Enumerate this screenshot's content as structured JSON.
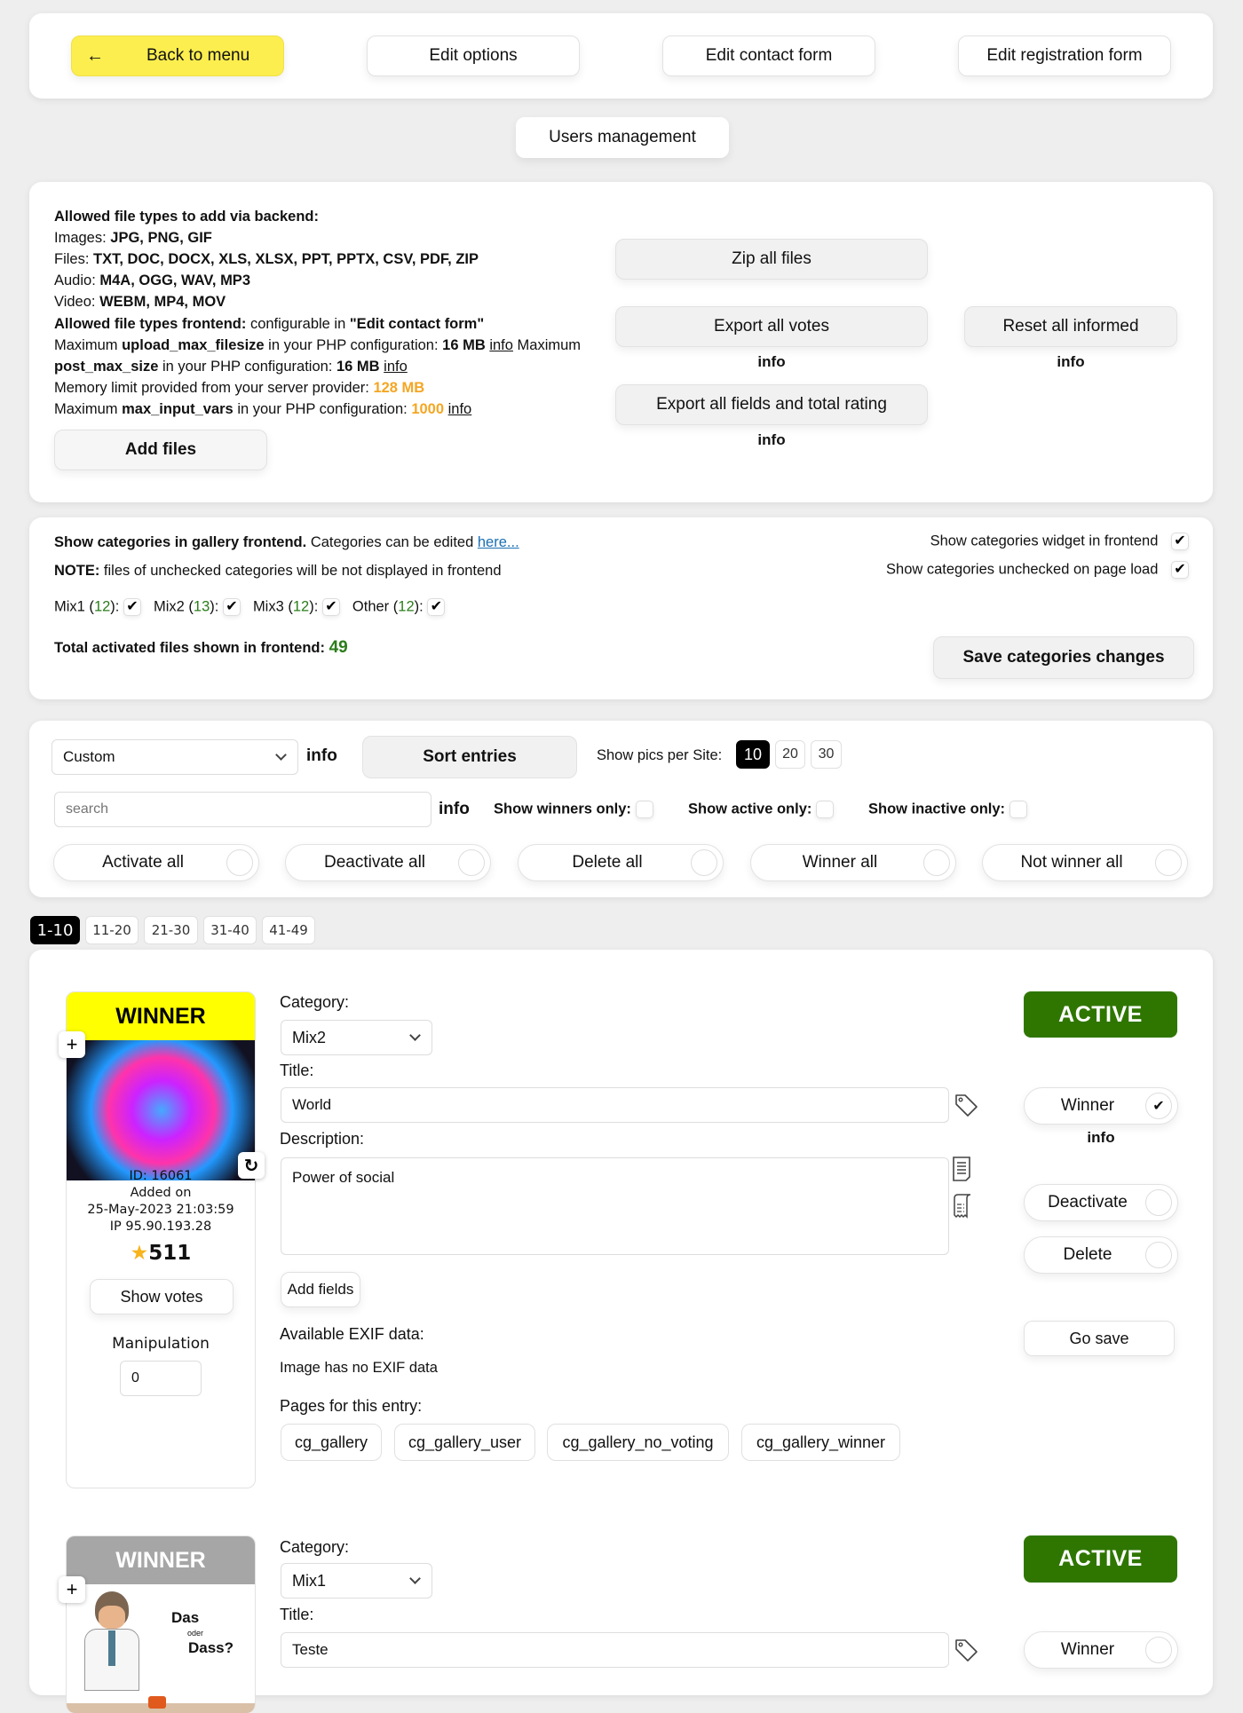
{
  "nav": {
    "back": "Back to menu",
    "edit_options": "Edit options",
    "edit_contact_form": "Edit contact form",
    "edit_registration_form": "Edit registration form",
    "users_management": "Users management"
  },
  "files_panel": {
    "heading": "Allowed file types to add via backend:",
    "images_label": "Images: ",
    "images_value": "JPG, PNG, GIF",
    "files_label": "Files: ",
    "files_value": "TXT, DOC, DOCX, XLS, XLSX, PPT, PPTX, CSV, PDF, ZIP",
    "audio_label": "Audio: ",
    "audio_value": "M4A, OGG, WAV, MP3",
    "video_label": "Video: ",
    "video_value": "WEBM, MP4, MOV",
    "frontend_label": "Allowed file types frontend:",
    "frontend_text": " configurable in ",
    "frontend_value": "\"Edit contact form\"",
    "upload_pre": "Maximum ",
    "upload_key": "upload_max_filesize",
    "upload_mid": " in your PHP configuration: ",
    "upload_value": "16 MB",
    "upload_info": "info",
    "upload_post": " Maximum",
    "post_key": "post_max_size",
    "post_mid": " in your PHP configuration: ",
    "post_value": "16 MB",
    "post_info": "info",
    "memory_text": "Memory limit provided from your server provider: ",
    "memory_value": "128 MB",
    "input_pre": "Maximum ",
    "input_key": "max_input_vars",
    "input_mid": " in your PHP configuration: ",
    "input_value": "1000",
    "input_info": "info",
    "add_files": "Add files",
    "zip_all": "Zip all files",
    "export_votes": "Export all votes",
    "export_votes_info": "info",
    "reset_informed": "Reset all informed",
    "reset_informed_info": "info",
    "export_fields": "Export all fields and total rating",
    "export_fields_info": "info"
  },
  "categories_panel": {
    "show_label": "Show categories in gallery frontend.",
    "edit_text": " Categories can be edited ",
    "edit_link": "here...",
    "note_label": "NOTE:",
    "note_text": " files of unchecked categories will be not displayed in frontend",
    "categories": [
      {
        "name": "Mix1",
        "count": "12",
        "checked": true
      },
      {
        "name": "Mix2",
        "count": "13",
        "checked": true
      },
      {
        "name": "Mix3",
        "count": "12",
        "checked": true
      },
      {
        "name": "Other",
        "count": "12",
        "checked": true
      }
    ],
    "total_label": "Total activated files shown in frontend:",
    "total_value": "49",
    "widget_label": "Show categories widget in frontend",
    "widget_checked": true,
    "unchecked_label": "Show categories unchecked on page load",
    "unchecked_checked": true,
    "save": "Save categories changes",
    "check_glyph": "✔"
  },
  "controls_panel": {
    "sort_select": "Custom",
    "sort_info": "info",
    "sort_button": "Sort entries",
    "per_site_label": "Show pics per Site:",
    "per_site_options": [
      "10",
      "20",
      "30"
    ],
    "per_site_selected": "10",
    "search_placeholder": "search",
    "search_value": "",
    "search_info": "info",
    "winners_only": "Show winners only:",
    "active_only": "Show active only:",
    "inactive_only": "Show inactive only:",
    "bulk": [
      "Activate all",
      "Deactivate all",
      "Delete all",
      "Winner all",
      "Not winner all"
    ]
  },
  "pagination": [
    "1-10",
    "11-20",
    "21-30",
    "31-40",
    "41-49"
  ],
  "pagination_selected": "1-10",
  "entries": [
    {
      "winner_label": "WINNER",
      "winner_color": "#ffff00",
      "id": "ID: 16061",
      "added_on": "Added on",
      "date": "25-May-2023 21:03:59",
      "ip": "IP 95.90.193.28",
      "rating": "511",
      "show_votes": "Show votes",
      "manipulation_label": "Manipulation",
      "manipulation_value": "0",
      "category_label": "Category:",
      "category_value": "Mix2",
      "title_label": "Title:",
      "title_value": "World",
      "description_label": "Description:",
      "description_value": "Power of social",
      "add_fields": "Add fields",
      "exif_label": "Available EXIF data:",
      "exif_value": "Image has no EXIF data",
      "pages_label": "Pages for this entry:",
      "pages": [
        "cg_gallery",
        "cg_gallery_user",
        "cg_gallery_no_voting",
        "cg_gallery_winner"
      ],
      "status": "ACTIVE",
      "winner_toggle": "Winner",
      "winner_checked": true,
      "winner_info": "info",
      "deactivate": "Deactivate",
      "delete": "Delete",
      "go_save": "Go save"
    },
    {
      "winner_label": "WINNER",
      "winner_color": "#a6a6a6",
      "image_text_1": "Das",
      "image_text_2": "oder",
      "image_text_3": "Dass?",
      "category_label": "Category:",
      "category_value": "Mix1",
      "title_label": "Title:",
      "title_value": "Teste",
      "status": "ACTIVE",
      "winner_toggle": "Winner",
      "winner_checked": false
    }
  ],
  "icons": {
    "back": "←",
    "plus": "+",
    "rotate": "↻",
    "star": "★",
    "check": "✔"
  }
}
